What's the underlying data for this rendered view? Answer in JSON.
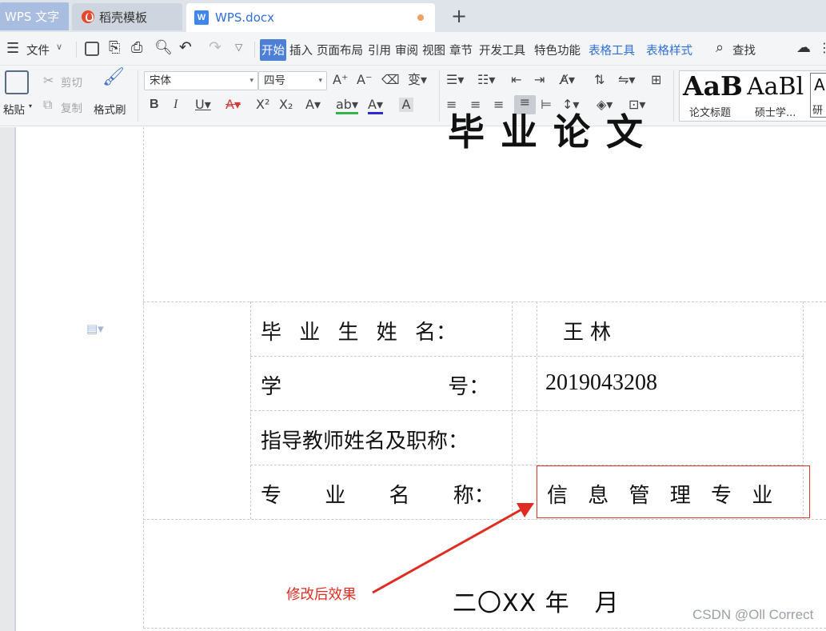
{
  "tabs": {
    "app_tab": "WPS 文字",
    "template_tab": "稻壳模板",
    "doc_tab": "WPS.docx",
    "new_tab": "+"
  },
  "menu": {
    "file": "文件",
    "items": [
      "开始",
      "插入",
      "页面布局",
      "引用",
      "审阅",
      "视图",
      "章节",
      "开发工具",
      "特色功能",
      "表格工具",
      "表格样式"
    ],
    "search": "查找"
  },
  "ribbon": {
    "paste": "粘贴",
    "cut": "剪切",
    "copy": "复制",
    "format_painter": "格式刷",
    "font_name": "宋体",
    "font_size": "四号",
    "style1_preview": "AaB",
    "style1_label": "论文标题",
    "style2_preview": "AaBl",
    "style2_label": "硕士学...",
    "style3_preview": "A",
    "style3_label": "研"
  },
  "document": {
    "title_cut": "毕业论文",
    "rows": [
      {
        "label": "毕 业 生 姓 名：",
        "value": "王林"
      },
      {
        "label": "学 号：",
        "value": "2019043208"
      },
      {
        "label": "指导教师姓名及职称：",
        "value": ""
      },
      {
        "label": "专 业 名 称：",
        "value": "信 息 管 理 专 业"
      }
    ],
    "annotation": "修改后效果",
    "date": "二〇XX 年　月"
  },
  "watermark": "CSDN @Oll Correct",
  "colors": {
    "accent": "#4d7fd6",
    "annotation_red": "#e02b20",
    "wps_tab": "#a9bde0"
  }
}
